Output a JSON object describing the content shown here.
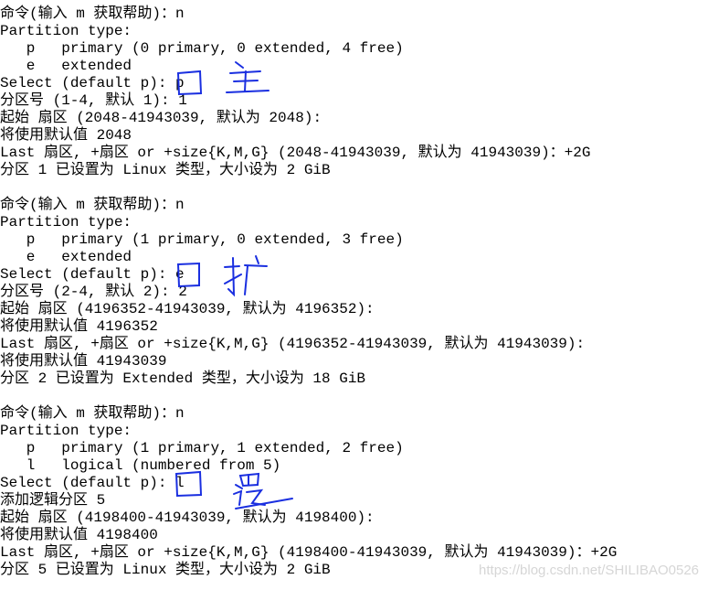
{
  "terminal": {
    "lines": [
      "命令(输入 m 获取帮助)：n",
      "Partition type:",
      "   p   primary (0 primary, 0 extended, 4 free)",
      "   e   extended",
      "Select (default p): p",
      "分区号 (1-4, 默认 1): 1",
      "起始 扇区 (2048-41943039, 默认为 2048):",
      "将使用默认值 2048",
      "Last 扇区, +扇区 or +size{K,M,G} (2048-41943039, 默认为 41943039)：+2G",
      "分区 1 已设置为 Linux 类型，大小设为 2 GiB",
      "",
      "命令(输入 m 获取帮助)：n",
      "Partition type:",
      "   p   primary (1 primary, 0 extended, 3 free)",
      "   e   extended",
      "Select (default p): e",
      "分区号 (2-4, 默认 2): 2",
      "起始 扇区 (4196352-41943039, 默认为 4196352):",
      "将使用默认值 4196352",
      "Last 扇区, +扇区 or +size{K,M,G} (4196352-41943039, 默认为 41943039):",
      "将使用默认值 41943039",
      "分区 2 已设置为 Extended 类型，大小设为 18 GiB",
      "",
      "命令(输入 m 获取帮助)：n",
      "Partition type:",
      "   p   primary (1 primary, 1 extended, 2 free)",
      "   l   logical (numbered from 5)",
      "Select (default p): l",
      "添加逻辑分区 5",
      "起始 扇区 (4198400-41943039, 默认为 4198400):",
      "将使用默认值 4198400",
      "Last 扇区, +扇区 or +size{K,M,G} (4198400-41943039, 默认为 41943039)：+2G",
      "分区 5 已设置为 Linux 类型，大小设为 2 GiB"
    ]
  },
  "annotations": {
    "color": "#1a2fe0",
    "handwritten": [
      "主",
      "扩",
      "逻"
    ]
  },
  "watermark": "https://blog.csdn.net/SHILIBAO0526"
}
